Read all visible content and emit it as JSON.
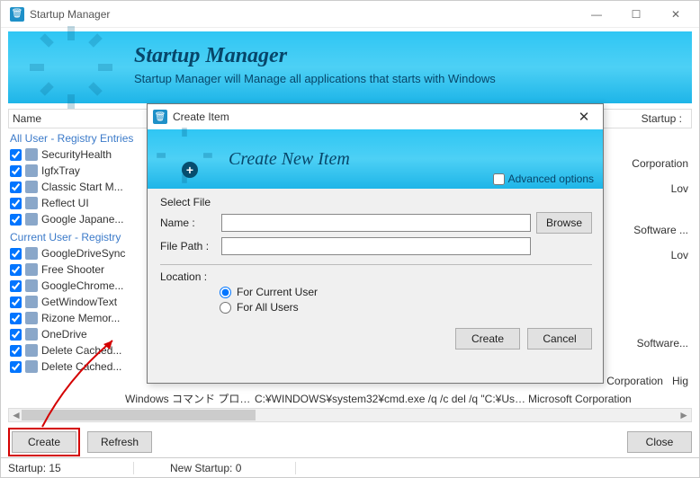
{
  "window": {
    "title": "Startup Manager"
  },
  "banner": {
    "title": "Startup Manager",
    "subtitle": "Startup Manager will Manage all applications that starts with Windows"
  },
  "columns": {
    "name": "Name",
    "startup": "Startup :"
  },
  "groups": {
    "allUser": "All User - Registry Entries",
    "currentUser": "Current User - Registry"
  },
  "items_all": [
    {
      "label": "SecurityHealth"
    },
    {
      "label": "IgfxTray"
    },
    {
      "label": "Classic Start M..."
    },
    {
      "label": "Reflect UI"
    },
    {
      "label": "Google Japane..."
    }
  ],
  "items_cur": [
    {
      "label": "GoogleDriveSync"
    },
    {
      "label": "Free Shooter"
    },
    {
      "label": "GoogleChrome..."
    },
    {
      "label": "GetWindowText"
    },
    {
      "label": "Rizone Memor..."
    },
    {
      "label": "OneDrive"
    },
    {
      "label": "Delete Cached..."
    },
    {
      "label": "Delete Cached..."
    }
  ],
  "right_labels": {
    "r1": "Corporation",
    "r2": "Lov",
    "r3": "Lov",
    "r4": "Software ...",
    "r5": "Lov",
    "r6": "Software...",
    "r7": "Corporation",
    "r8": "Hig"
  },
  "bottom": {
    "desc": "Windows コマンド プロセッサ",
    "path": "C:¥WINDOWS¥system32¥cmd.exe /q /c del /q \"C:¥Users...",
    "vendor": "Microsoft Corporation"
  },
  "buttons": {
    "create": "Create",
    "refresh": "Refresh",
    "close": "Close"
  },
  "status": {
    "startup": "Startup: 15",
    "newstartup": "New Startup: 0"
  },
  "dialog": {
    "title": "Create Item",
    "banner": "Create New Item",
    "advanced": "Advanced options",
    "section_select": "Select File",
    "name_label": "Name :",
    "path_label": "File Path :",
    "browse": "Browse",
    "location_label": "Location :",
    "radio_current": "For Current User",
    "radio_all": "For All Users",
    "create": "Create",
    "cancel": "Cancel"
  }
}
